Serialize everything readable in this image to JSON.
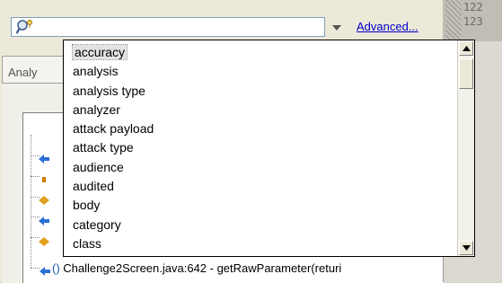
{
  "toolbar": {
    "advanced_label": "Advanced...",
    "search_value": ""
  },
  "tabs": [
    {
      "label": "Analy"
    }
  ],
  "suggestions": {
    "selected_index": 0,
    "items": [
      "accuracy",
      "analysis",
      "analysis type",
      "analyzer",
      "attack payload",
      "attack type",
      "audience",
      "audited",
      "body",
      "category",
      "class"
    ]
  },
  "trace": {
    "paren": "()",
    "text": "Challenge2Screen.java:642 - getRawParameter(returi"
  },
  "right_numbers": [
    "122",
    "123"
  ],
  "icons": {
    "search": "search-magnifier-icon",
    "dropdown": "chevron-down-icon",
    "scroll_up": "arrow-up-icon",
    "scroll_down": "arrow-down-icon"
  },
  "colors": {
    "link": "#0000cc",
    "popup_border": "#000000",
    "selected_item_bg": "#e3e3e3"
  }
}
